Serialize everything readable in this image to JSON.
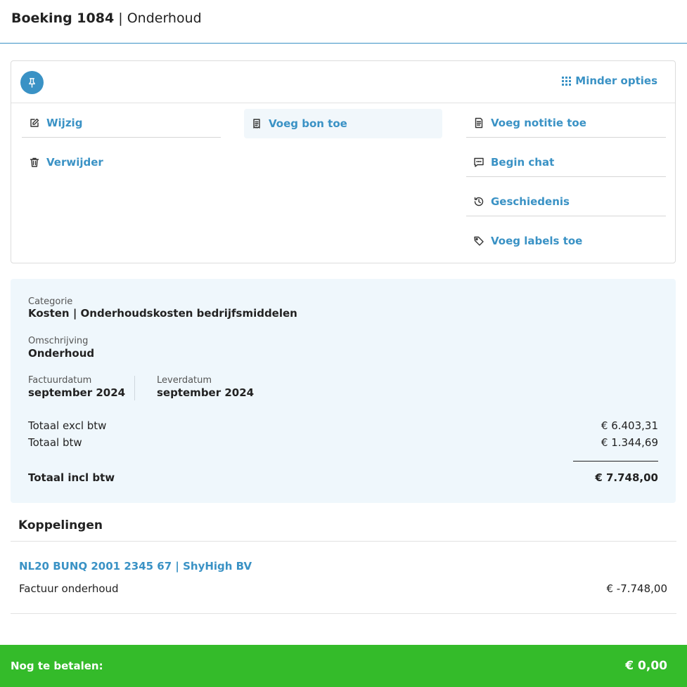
{
  "header": {
    "title": "Boeking 1084",
    "separator": "|",
    "subtitle": "Onderhoud"
  },
  "options": {
    "pin_icon": "pin-icon",
    "less_options_label": "Minder opties",
    "actions": {
      "edit": "Wijzig",
      "add_receipt": "Voeg bon toe",
      "add_note": "Voeg notitie toe",
      "delete": "Verwijder",
      "start_chat": "Begin chat",
      "history": "Geschiedenis",
      "add_labels": "Voeg labels toe"
    }
  },
  "summary": {
    "category_label": "Categorie",
    "category_value": "Kosten | Onderhoudskosten bedrijfsmiddelen",
    "description_label": "Omschrijving",
    "description_value": "Onderhoud",
    "invoice_date_label": "Factuurdatum",
    "invoice_date_value": "september 2024",
    "delivery_date_label": "Leverdatum",
    "delivery_date_value": "september 2024",
    "totals": {
      "excl_label": "Totaal excl btw",
      "excl_value": "€ 6.403,31",
      "vat_label": "Totaal btw",
      "vat_value": "€ 1.344,69",
      "incl_label": "Totaal incl btw",
      "incl_value": "€ 7.748,00"
    }
  },
  "links": {
    "title": "Koppelingen",
    "items": [
      {
        "account": "NL20 BUNQ 2001 2345 67 | ShyHigh BV",
        "description": "Factuur onderhoud",
        "amount": "€ -7.748,00"
      }
    ]
  },
  "footer": {
    "label": "Nog te betalen:",
    "amount": "€ 0,00"
  },
  "colors": {
    "accent": "#3a92c5",
    "success": "#34bb2a",
    "panel": "#eff7fc"
  }
}
